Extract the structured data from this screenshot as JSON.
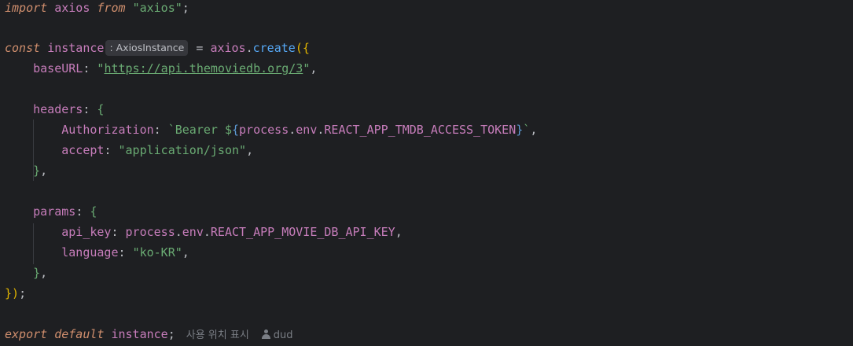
{
  "code": {
    "l1": {
      "kw_import": "import",
      "id": "axios",
      "kw_from": "from",
      "str": "\"axios\"",
      "semi": ";"
    },
    "l3": {
      "kw_const": "const",
      "name": "instance",
      "type_hint": ": AxiosInstance",
      "eq": "= ",
      "obj": "axios",
      "dot": ".",
      "fn": "create",
      "open_paren": "(",
      "open_brace": "{"
    },
    "l4": {
      "key": "baseURL",
      "colon": ": ",
      "q1": "\"",
      "url": "https://api.themoviedb.org/3",
      "q2": "\"",
      "comma": ","
    },
    "l6": {
      "key": "headers",
      "colon": ": ",
      "brace": "{"
    },
    "l7": {
      "key": "Authorization",
      "colon": ": ",
      "tmpl_start": "`Bearer ",
      "dollar": "$",
      "open": "{",
      "expr_obj": "process",
      "dot1": ".",
      "expr_env": "env",
      "dot2": ".",
      "expr_var": "REACT_APP_TMDB_ACCESS_TOKEN",
      "close": "}",
      "tmpl_end": "`",
      "comma": ","
    },
    "l8": {
      "key": "accept",
      "colon": ": ",
      "str": "\"application/json\"",
      "comma": ","
    },
    "l9": {
      "close": "}",
      "comma": ","
    },
    "l11": {
      "key": "params",
      "colon": ": ",
      "brace": "{"
    },
    "l12": {
      "key": "api_key",
      "colon": ": ",
      "obj": "process",
      "dot1": ".",
      "env": "env",
      "dot2": ".",
      "var": "REACT_APP_MOVIE_DB_API_KEY",
      "comma": ","
    },
    "l13": {
      "key": "language",
      "colon": ": ",
      "str": "\"ko-KR\"",
      "comma": ","
    },
    "l14": {
      "close": "}",
      "comma": ","
    },
    "l15": {
      "close_brace": "}",
      "close_paren": ")",
      "semi": ";"
    },
    "l17": {
      "kw_export": "export",
      "kw_default": "default",
      "name": "instance",
      "semi": ";",
      "usages_hint": "사용 위치 표시",
      "author": "dud"
    }
  },
  "colors": {
    "background": "#1e1f22",
    "keyword": "#cf8e6d",
    "property": "#c77dbb",
    "function": "#56a8f5",
    "string": "#6aab73",
    "brace": "#e0b400",
    "text": "#bcbec4"
  }
}
